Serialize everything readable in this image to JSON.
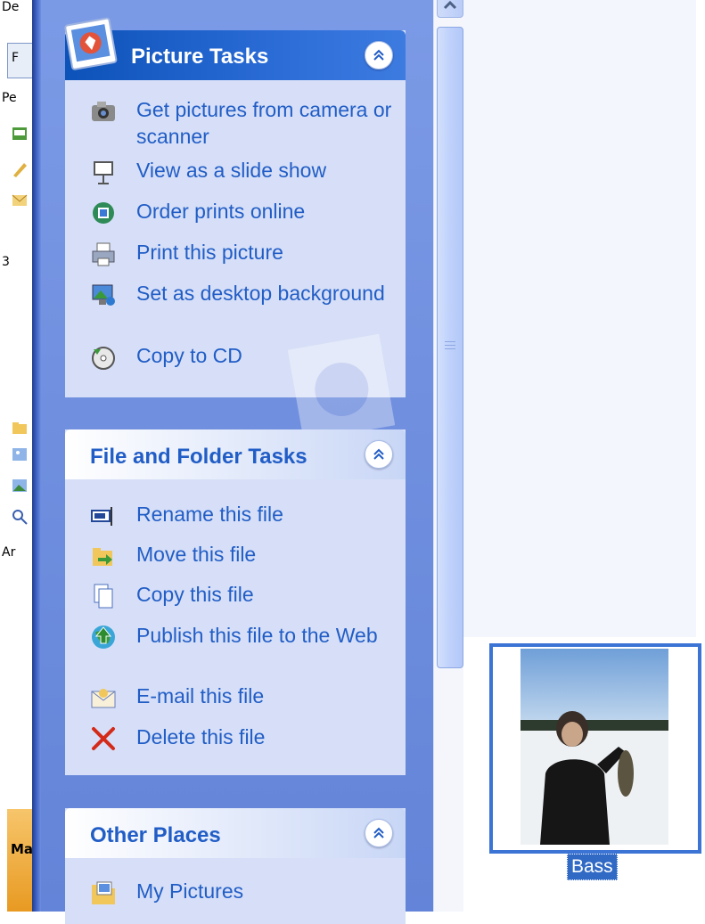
{
  "left_strip": {
    "fragments": [
      "De",
      "F",
      "Pe",
      "3",
      "Ar"
    ],
    "orange_tab_text": "Ma"
  },
  "task_pane": {
    "picture_tasks": {
      "title": "Picture Tasks",
      "items": [
        {
          "label": "Get pictures from camera or scanner",
          "icon": "camera-icon"
        },
        {
          "label": "View as a slide show",
          "icon": "slideshow-icon"
        },
        {
          "label": "Order prints online",
          "icon": "order-prints-icon"
        },
        {
          "label": "Print this picture",
          "icon": "printer-icon"
        },
        {
          "label": "Set as desktop background",
          "icon": "desktop-background-icon"
        },
        {
          "label": "Copy to CD",
          "icon": "cd-icon"
        }
      ]
    },
    "file_folder_tasks": {
      "title": "File and Folder Tasks",
      "items": [
        {
          "label": "Rename this file",
          "icon": "rename-icon"
        },
        {
          "label": "Move this file",
          "icon": "move-icon"
        },
        {
          "label": "Copy this file",
          "icon": "copy-icon"
        },
        {
          "label": "Publish this file to the Web",
          "icon": "publish-web-icon"
        },
        {
          "label": "E-mail this file",
          "icon": "email-icon"
        },
        {
          "label": "Delete this file",
          "icon": "delete-icon"
        }
      ]
    },
    "other_places": {
      "title": "Other Places",
      "items": [
        {
          "label": "My Pictures",
          "icon": "my-pictures-icon"
        }
      ]
    }
  },
  "file_view": {
    "selected_file": {
      "name": "Bass"
    }
  },
  "colors": {
    "link_blue": "#215dc6",
    "pane_blue": "#6f8ede",
    "panel_body": "#d6dff7",
    "selection_blue": "#316ac5"
  }
}
